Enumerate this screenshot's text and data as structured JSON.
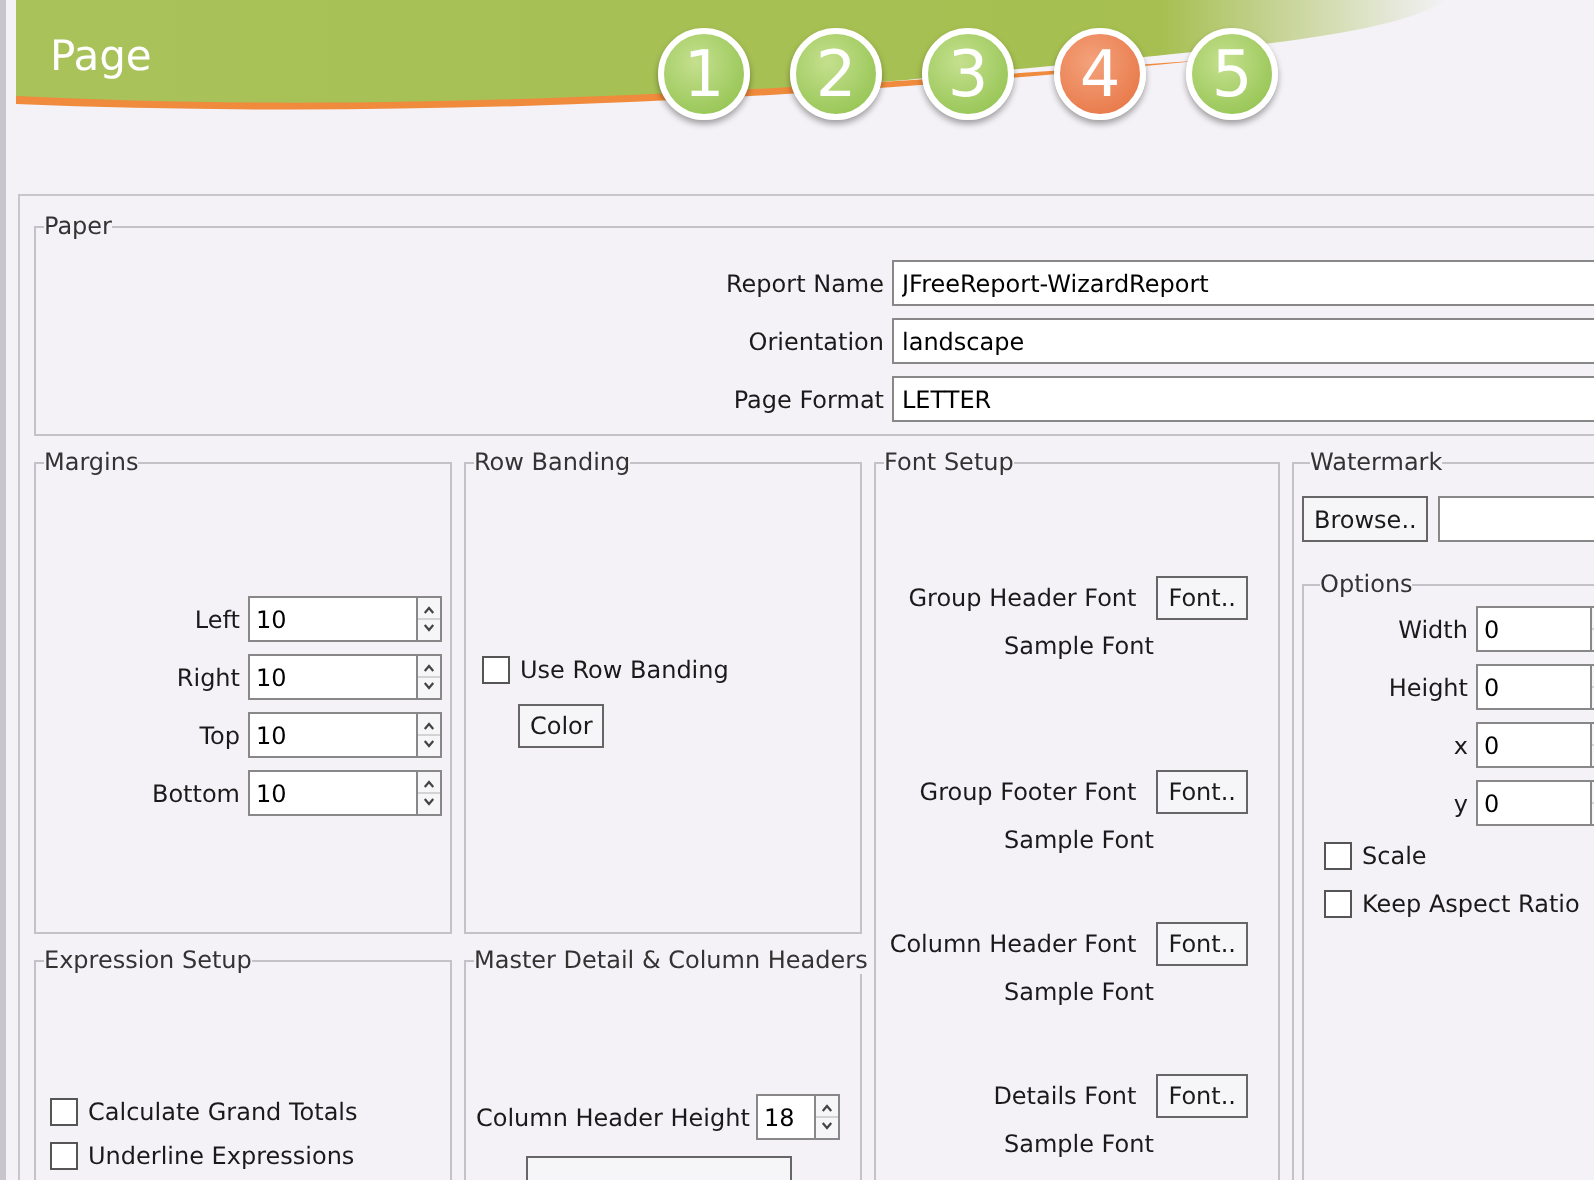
{
  "header": {
    "title": "Page",
    "steps": [
      {
        "label": "1",
        "selected": false
      },
      {
        "label": "2",
        "selected": false
      },
      {
        "label": "3",
        "selected": false
      },
      {
        "label": "4",
        "selected": true
      },
      {
        "label": "5",
        "selected": false
      }
    ]
  },
  "paper": {
    "title": "Paper",
    "fields": [
      {
        "label": "Report Name",
        "value": "JFreeReport-WizardReport"
      },
      {
        "label": "Orientation",
        "value": "landscape"
      },
      {
        "label": "Page Format",
        "value": "LETTER"
      }
    ]
  },
  "margins": {
    "title": "Margins",
    "fields": [
      {
        "label": "Left",
        "value": "10"
      },
      {
        "label": "Right",
        "value": "10"
      },
      {
        "label": "Top",
        "value": "10"
      },
      {
        "label": "Bottom",
        "value": "10"
      }
    ]
  },
  "row_banding": {
    "title": "Row Banding",
    "checkbox": {
      "label": "Use Row Banding",
      "checked": false
    },
    "button": "Color"
  },
  "font_setup": {
    "title": "Font Setup",
    "items": [
      {
        "label": "Group Header Font",
        "button": "Font..",
        "sample": "Sample Font"
      },
      {
        "label": "Group Footer Font",
        "button": "Font..",
        "sample": "Sample Font"
      },
      {
        "label": "Column Header Font",
        "button": "Font..",
        "sample": "Sample Font"
      },
      {
        "label": "Details Font",
        "button": "Font..",
        "sample": "Sample Font"
      }
    ]
  },
  "watermark": {
    "title": "Watermark",
    "browse_button": "Browse..",
    "options": {
      "title": "Options",
      "fields": [
        {
          "label": "Width",
          "value": "0"
        },
        {
          "label": "Height",
          "value": "0"
        },
        {
          "label": "x",
          "value": "0"
        },
        {
          "label": "y",
          "value": "0"
        }
      ],
      "checkboxes": [
        {
          "label": "Scale",
          "checked": false
        },
        {
          "label": "Keep Aspect Ratio",
          "checked": false
        }
      ]
    }
  },
  "expression_setup": {
    "title": "Expression Setup",
    "checkboxes": [
      {
        "label": "Calculate Grand Totals",
        "checked": false
      },
      {
        "label": "Underline Expressions",
        "checked": false
      }
    ]
  },
  "master_detail": {
    "title": "Master Detail & Column Headers",
    "field": {
      "label": "Column Header Height",
      "value": "18"
    }
  }
}
